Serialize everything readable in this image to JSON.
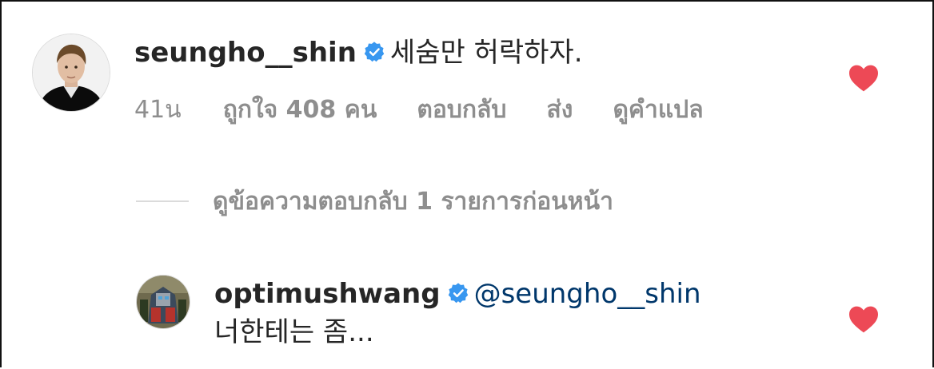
{
  "comment": {
    "username": "seungho__shin",
    "verified_icon": "verified-badge-icon",
    "text": "세숨만 허락하자.",
    "time": "41น",
    "likes": "ถูกใจ 408 คน",
    "reply_label": "ตอบกลับ",
    "send_label": "ส่ง",
    "translate_label": "ดูคำแปล",
    "liked": true,
    "like_icon": "heart-filled-icon"
  },
  "view_replies": {
    "label": "ดูข้อความตอบกลับ 1 รายการก่อนหน้า"
  },
  "reply": {
    "username": "optimushwang",
    "verified_icon": "verified-badge-icon",
    "mention": "@seungho__shin",
    "text": "너한테는 좀...",
    "liked": true,
    "like_icon": "heart-filled-icon"
  },
  "colors": {
    "heart": "#ed4956",
    "verified": "#3897f0",
    "mention": "#00376b",
    "secondary_text": "#8e8e8e"
  }
}
